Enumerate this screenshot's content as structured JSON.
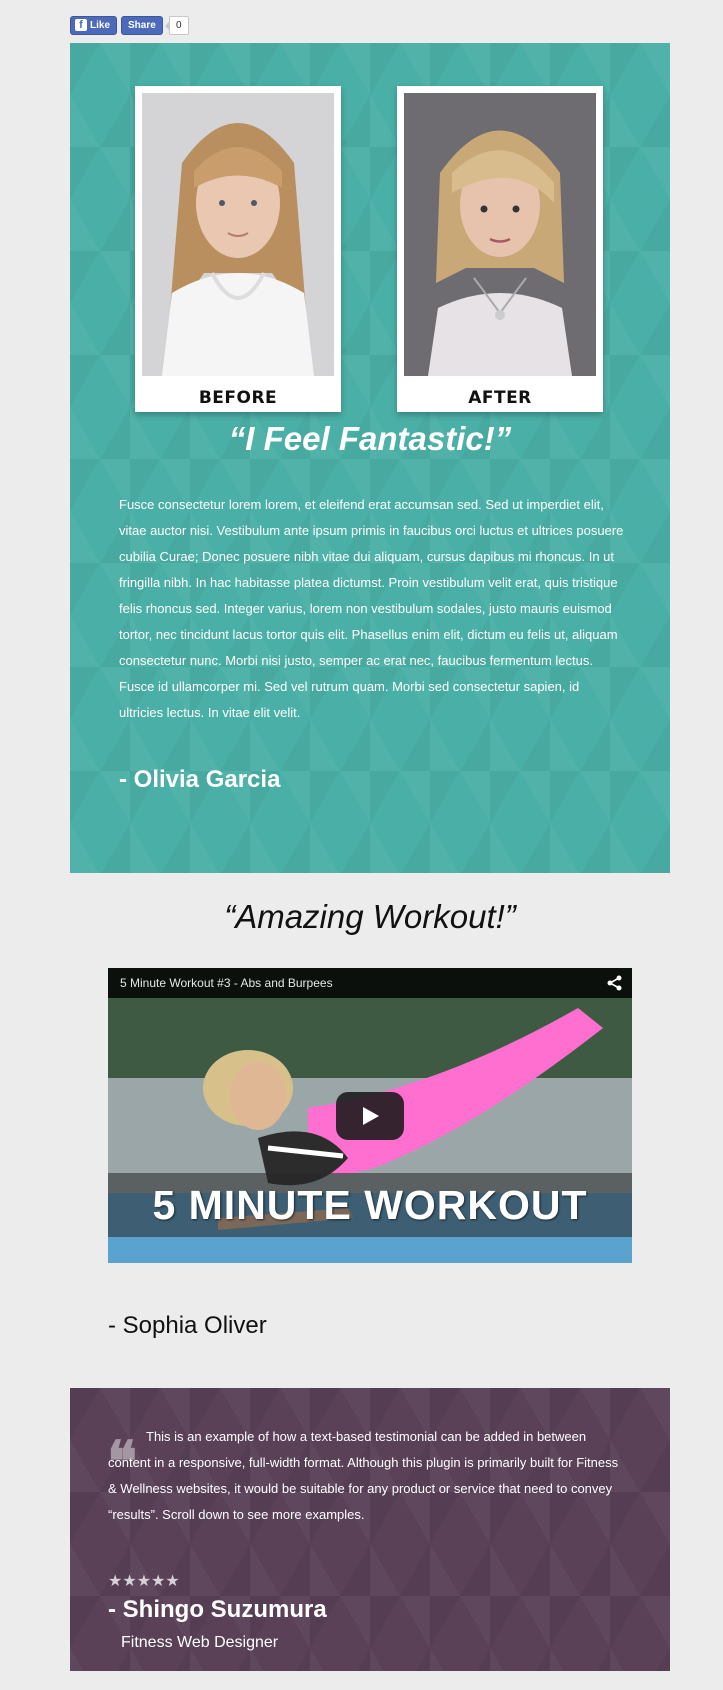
{
  "social": {
    "like_label": "Like",
    "like_icon": "facebook-f-icon",
    "share_label": "Share",
    "share_count": "0"
  },
  "testimonial_1": {
    "before_label": "BEFORE",
    "after_label": "AFTER",
    "quote": "“I Feel Fantastic!”",
    "body": "Fusce consectetur lorem lorem, et eleifend erat accumsan sed. Sed ut imperdiet elit, vitae auctor nisi. Vestibulum ante ipsum primis in faucibus orci luctus et ultrices posuere cubilia Curae; Donec posuere nibh vitae dui aliquam, cursus dapibus mi rhoncus. In ut fringilla nibh. In hac habitasse platea dictumst. Proin vestibulum velit erat, quis tristique felis rhoncus sed. Integer varius, lorem non vestibulum sodales, justo mauris euismod tortor, nec tincidunt lacus tortor quis elit. Phasellus enim elit, dictum eu felis ut, aliquam consectetur nunc. Morbi nisi justo, semper ac erat nec, faucibus fermentum lectus. Fusce id ullamcorper mi. Sed vel rutrum quam. Morbi sed consectetur sapien, id ultricies lectus. In vitae elit velit.",
    "author": "- Olivia Garcia",
    "accent_color": "#4aafa6"
  },
  "testimonial_2": {
    "quote": "“Amazing Workout!”",
    "video_title": "5 Minute Workout #3 - Abs and Burpees",
    "video_banner": "5 MINUTE WORKOUT",
    "share_icon": "share-icon",
    "play_icon": "play-icon",
    "author": "- Sophia Oliver"
  },
  "testimonial_3": {
    "quote_icon": "quote-icon",
    "body": "This is an example of how a text-based testimonial can be added in between content in a responsive, full-width format. Although this plugin is primarily built for Fitness & Wellness websites, it would be suitable for any product or service that need to convey “results”. Scroll down to see more examples.",
    "stars": "★★★★★",
    "rating": 5,
    "author": "- Shingo Suzumura",
    "role": "Fitness Web Designer",
    "accent_color": "#5a4158"
  }
}
